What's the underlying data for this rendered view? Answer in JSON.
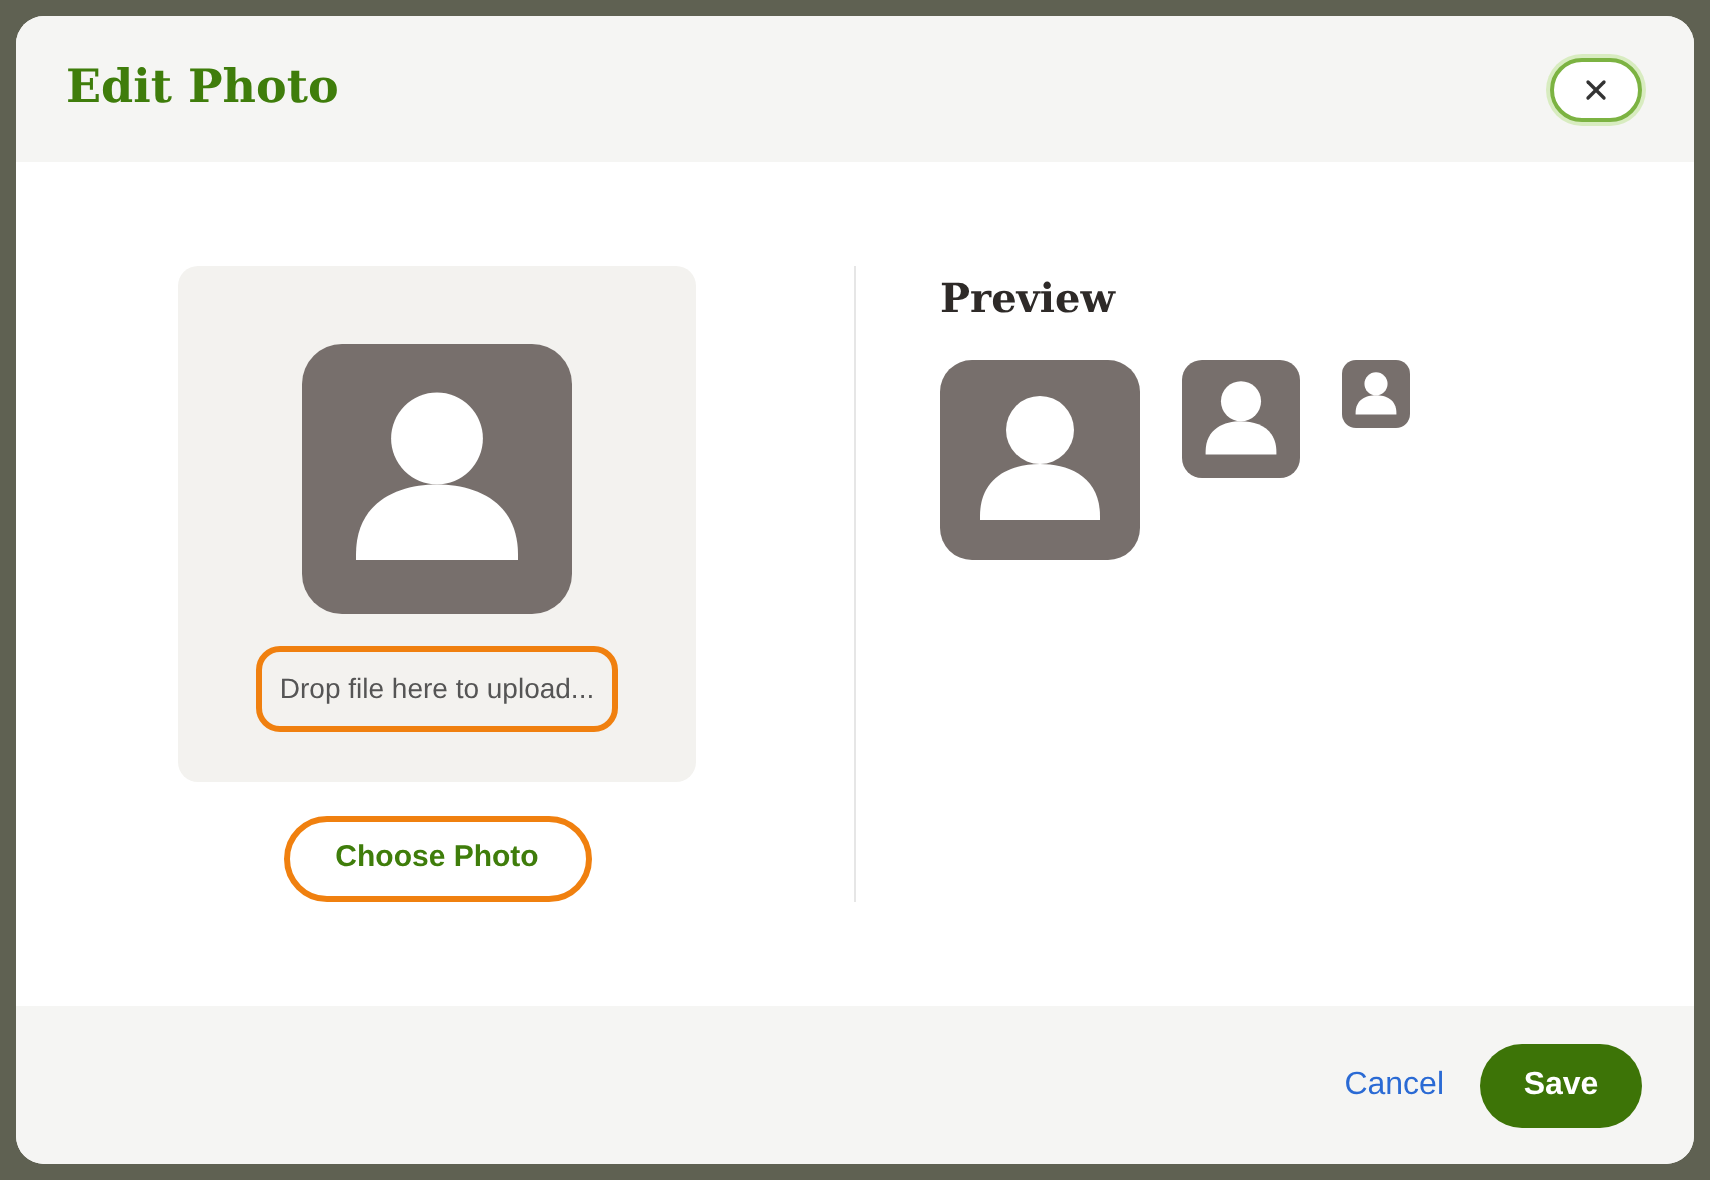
{
  "dialog": {
    "title": "Edit Photo",
    "close_button": {
      "focused": true
    }
  },
  "upload": {
    "drop_hint": "Drop file here to upload...",
    "drop_focused": true,
    "choose_button": {
      "label": "Choose Photo",
      "focused": true
    }
  },
  "preview": {
    "title": "Preview",
    "avatars": [
      {
        "kind": "large"
      },
      {
        "kind": "medium"
      },
      {
        "kind": "small"
      }
    ]
  },
  "footer": {
    "cancel": "Cancel",
    "save": "Save"
  }
}
